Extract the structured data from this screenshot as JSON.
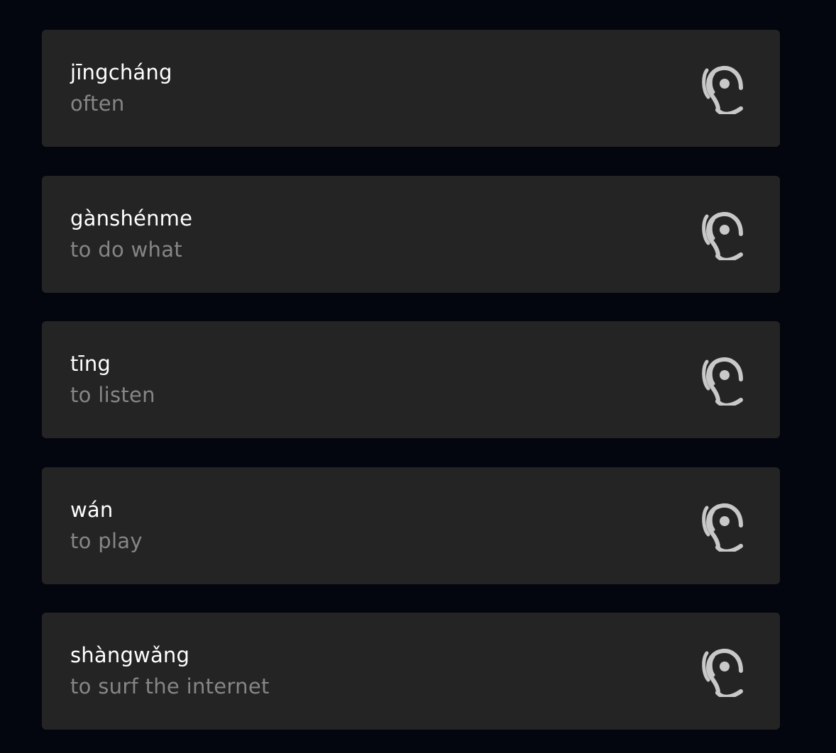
{
  "vocab": {
    "items": [
      {
        "pinyin": "jīngcháng",
        "meaning": "often",
        "audio_icon": "listen-ear-icon"
      },
      {
        "pinyin": "gànshénme",
        "meaning": "to do what",
        "audio_icon": "listen-ear-icon"
      },
      {
        "pinyin": "tīng",
        "meaning": "to listen",
        "audio_icon": "listen-ear-icon"
      },
      {
        "pinyin": "wán",
        "meaning": "to play",
        "audio_icon": "listen-ear-icon"
      },
      {
        "pinyin": "shàngwǎng",
        "meaning": "to surf the internet",
        "audio_icon": "listen-ear-icon"
      }
    ]
  },
  "colors": {
    "background": "#04060f",
    "card": "#242424",
    "pinyin_text": "#ffffff",
    "meaning_text": "#868686",
    "icon": "#c8c8c8"
  }
}
